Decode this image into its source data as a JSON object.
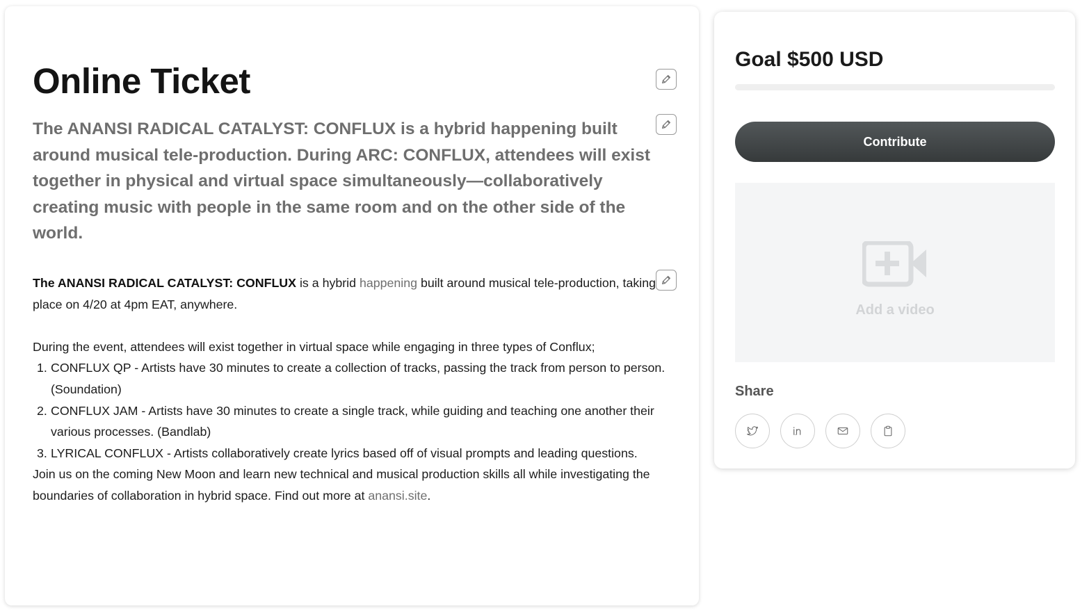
{
  "main": {
    "title": "Online Ticket",
    "lead": "The ANANSI RADICAL CATALYST: CONFLUX is a hybrid happening built around musical tele-production. During ARC: CONFLUX, attendees will exist together in physical and virtual space simultaneously—collaboratively creating music with people in the same room and on the other side of the world.",
    "body": {
      "intro_strong": "The ANANSI RADICAL CATALYST: CONFLUX",
      "intro_text_1": " is a hybrid ",
      "intro_link": "happening",
      "intro_text_2": " built around musical tele-production, taking place on 4/20 at 4pm EAT, anywhere.",
      "during": "During the event, attendees will exist together in virtual space while engaging in three types of Conflux;",
      "list": [
        {
          "num": "1.",
          "text": "CONFLUX QP - Artists have 30 minutes to create a collection of tracks, passing the track from person to person. (Soundation)"
        },
        {
          "num": "2.",
          "text": "CONFLUX JAM - Artists have 30 minutes to create a single track, while guiding and teaching one another their various processes. (Bandlab)"
        },
        {
          "num": "3.",
          "text": "LYRICAL CONFLUX - Artists collaboratively create lyrics based off of visual prompts and leading questions."
        }
      ],
      "closing_text": "Join us on the coming New Moon and learn new technical and musical production skills all  while investigating the boundaries of collaboration in hybrid space. Find out more at ",
      "closing_link": "anansi.site",
      "closing_end": "."
    }
  },
  "sidebar": {
    "goal": "Goal $500 USD",
    "progress_fraction": 0,
    "contribute_label": "Contribute",
    "video_label": "Add a video",
    "share_label": "Share",
    "share_buttons": [
      "twitter-icon",
      "linkedin-icon",
      "email-icon",
      "clipboard-icon"
    ]
  },
  "colors": {
    "button_dark": "#3f4344",
    "lead_text": "#6e6e6e",
    "link": "#6f6f6f",
    "video_bg": "#f4f5f6"
  }
}
